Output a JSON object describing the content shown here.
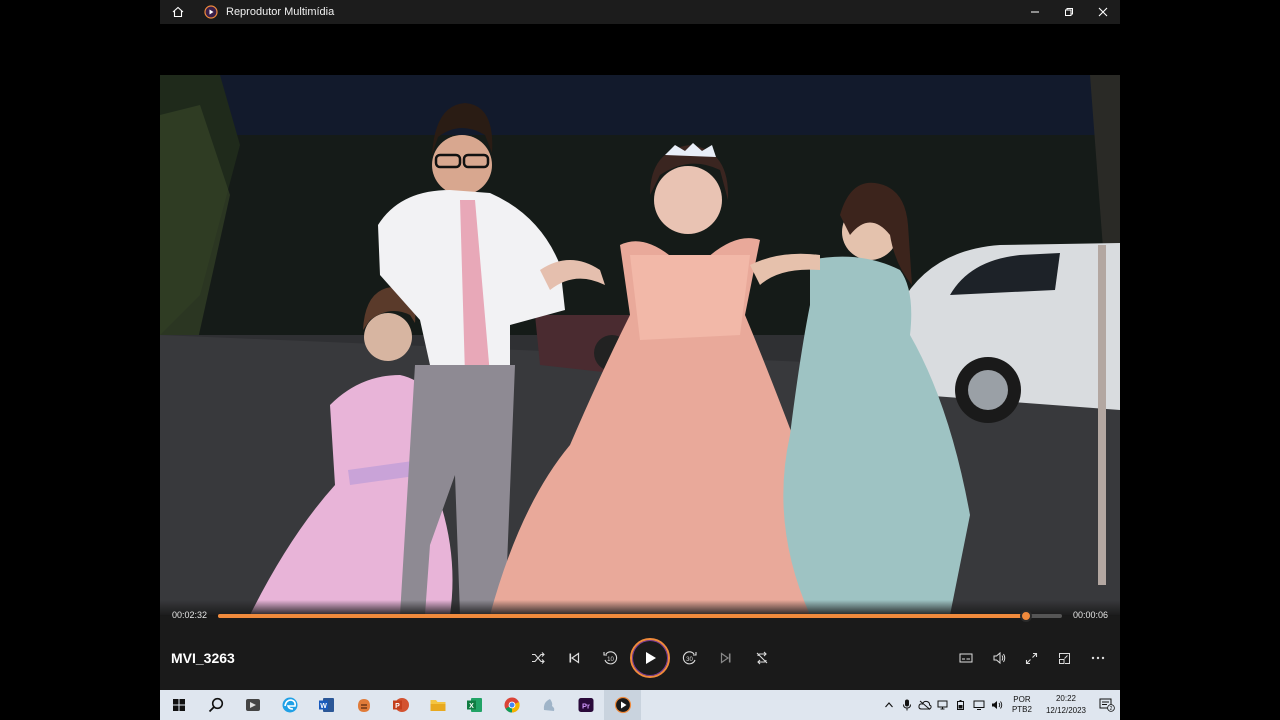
{
  "window": {
    "title": "Reprodutor Multimídia"
  },
  "player": {
    "elapsed": "00:02:32",
    "remaining": "00:00:06",
    "progress": 0.957,
    "media_title": "MVI_3263",
    "accent_color": "#f08a3c"
  },
  "controls": {
    "icons": [
      "shuffle-icon",
      "previous-icon",
      "skip-back-10-icon",
      "play-icon",
      "skip-forward-30-icon",
      "next-icon",
      "repeat-icon"
    ],
    "skip_back_label": "10",
    "skip_forward_label": "30"
  },
  "right_controls": {
    "icons": [
      "subtitles-icon",
      "volume-icon",
      "fullscreen-icon",
      "mini-player-icon",
      "more-icon"
    ]
  },
  "taskbar": {
    "apps": [
      "windows-start-icon",
      "search-icon",
      "media-app-icon",
      "edge-icon",
      "word-icon",
      "app-icon",
      "powerpoint-icon",
      "file-explorer-icon",
      "excel-icon",
      "chrome-icon",
      "app-icon",
      "premiere-icon",
      "media-player-icon"
    ],
    "language_top": "POR",
    "language_bottom": "PTB2",
    "time": "20:22",
    "date": "12/12/2023",
    "notification_count": "2"
  }
}
